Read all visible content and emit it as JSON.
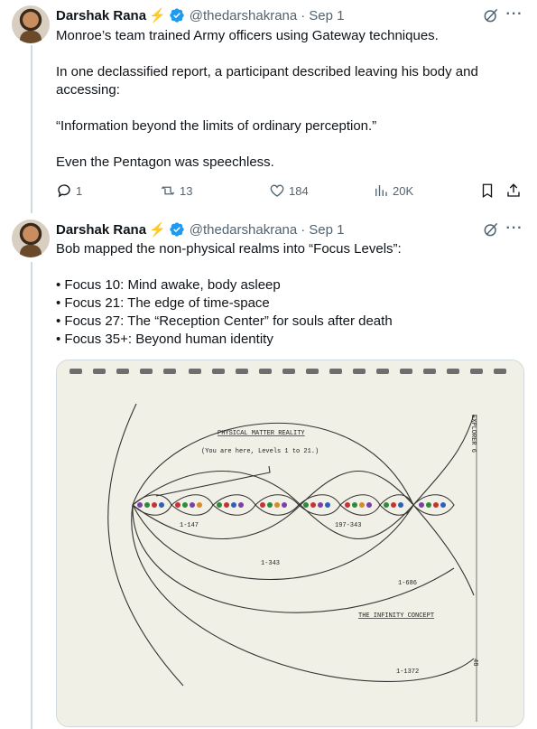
{
  "tweets": [
    {
      "author_name": "Darshak Rana",
      "handle": "@thedarshakrana",
      "separator": "·",
      "date": "Sep 1",
      "paragraphs": [
        "Monroe’s team trained Army officers using Gateway techniques.",
        "In one declassified report, a participant described leaving his body and accessing:",
        "“Information beyond the limits of ordinary perception.”",
        "Even the Pentagon was speechless."
      ],
      "stats": {
        "replies": "1",
        "reposts": "13",
        "likes": "184",
        "views": "20K"
      }
    },
    {
      "author_name": "Darshak Rana",
      "handle": "@thedarshakrana",
      "separator": "·",
      "date": "Sep 1",
      "intro": "Bob mapped the non-physical realms into “Focus Levels”:",
      "focus_levels": [
        "• Focus 10: Mind awake, body asleep",
        "• Focus 21: The edge of time-space",
        "• Focus 27: The “Reception Center” for souls after death",
        "• Focus 35+: Beyond human identity"
      ]
    }
  ],
  "diagram": {
    "title": "PHYSICAL MATTER REALITY",
    "subtitle": "(You are here, Levels 1 to 21.)",
    "labels": {
      "small_left": "1-147",
      "small_right": "197-343",
      "mid": "1-343",
      "large": "1-686",
      "largest": "1-1372",
      "concept": "THE INFINITY CONCEPT",
      "side_title": "EXPLORER 6",
      "page_number": "48"
    }
  },
  "icons": {
    "bolt": "lightning-bolt-emoji",
    "verified": "verified-badge-icon",
    "grok": "grok-icon",
    "more": "more-icon",
    "reply": "reply-icon",
    "repost": "repost-icon",
    "like": "like-icon",
    "views": "views-icon",
    "bookmark": "bookmark-icon",
    "share": "share-icon"
  },
  "colors": {
    "verified": "#1d9bf0",
    "secondary_text": "#536471",
    "paper": "#f1f0e6"
  }
}
